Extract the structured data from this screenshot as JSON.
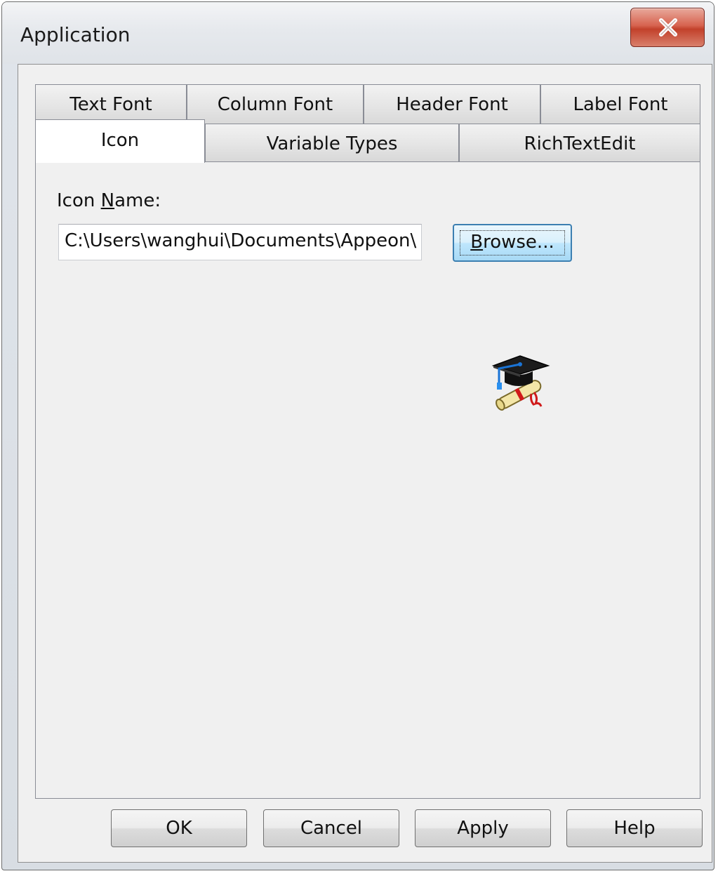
{
  "window": {
    "title": "Application"
  },
  "tabs": {
    "row1": [
      {
        "label": "Text Font"
      },
      {
        "label": "Column Font"
      },
      {
        "label": "Header Font"
      },
      {
        "label": "Label Font"
      }
    ],
    "row2": [
      {
        "label": "Icon",
        "active": true
      },
      {
        "label": "Variable Types"
      },
      {
        "label": "RichTextEdit"
      }
    ]
  },
  "icon_tab": {
    "icon_name_label_prefix": "Icon ",
    "icon_name_label_mnemonic": "N",
    "icon_name_label_suffix": "ame:",
    "icon_name_value": "C:\\Users\\wanghui\\Documents\\Appeon\\",
    "browse_label_mnemonic": "B",
    "browse_label_rest": "rowse...",
    "preview_icon": "graduation-cap-diploma-icon"
  },
  "buttons": {
    "ok": "OK",
    "cancel": "Cancel",
    "apply": "Apply",
    "help": "Help"
  },
  "colors": {
    "close_button": "#c2412b",
    "focus_button_border": "#3c7fb1"
  }
}
